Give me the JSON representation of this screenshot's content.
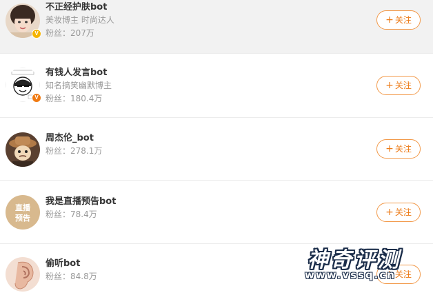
{
  "follow_label": "关注",
  "users": [
    {
      "name": "不正经护肤bot",
      "desc": "美妆博主 时尚达人",
      "fans": "粉丝：207万",
      "verified": "gold",
      "badge_letter": "V"
    },
    {
      "name": "有钱人发言bot",
      "desc": "知名搞笑幽默博主",
      "fans": "粉丝：180.4万",
      "verified": "orange",
      "badge_letter": "V"
    },
    {
      "name": "周杰伦_bot",
      "desc": "",
      "fans": "粉丝：278.1万"
    },
    {
      "name": "我是直播预告bot",
      "desc": "",
      "fans": "粉丝：78.4万",
      "avatar_text": [
        "直播",
        "预告"
      ]
    },
    {
      "name": "偷听bot",
      "desc": "",
      "fans": "粉丝：84.8万"
    }
  ],
  "watermark": {
    "title": "神奇评测",
    "url": "www.vssq.cn"
  },
  "colors": {
    "accent": "#ec7a16",
    "highlight_row": "#f2f2f2",
    "badge_gold": "#f5b400",
    "badge_orange": "#f07a12"
  }
}
